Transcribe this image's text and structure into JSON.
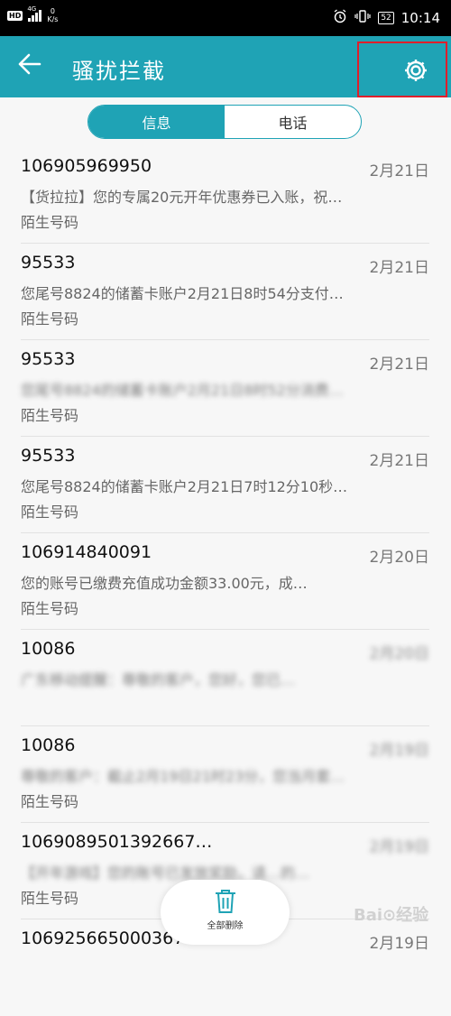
{
  "status_bar": {
    "hd": "HD",
    "signal_label": "4G",
    "speed_value": "0",
    "speed_unit": "K/s",
    "battery": "52",
    "time": "10:14"
  },
  "app_bar": {
    "title": "骚扰拦截",
    "back_icon": "arrow-left-icon",
    "settings_icon": "gear-icon",
    "highlight_color": "#e01e2b"
  },
  "tabs": [
    {
      "label": "信息",
      "active": true
    },
    {
      "label": "电话",
      "active": false
    }
  ],
  "messages": [
    {
      "sender": "106905969950",
      "date": "2月21日",
      "snippet": "【货拉拉】您的专属20元开年优惠券已入账，祝…",
      "tag": "陌生号码"
    },
    {
      "sender": "95533",
      "date": "2月21日",
      "snippet": "您尾号8824的储蓄卡账户2月21日8时54分支付…",
      "tag": "陌生号码"
    },
    {
      "sender": "95533",
      "date": "2月21日",
      "snippet": "您尾号8824的储蓄卡账户2月21日8时52分消费…",
      "tag": "陌生号码"
    },
    {
      "sender": "95533",
      "date": "2月21日",
      "snippet": "您尾号8824的储蓄卡账户2月21日7时12分10秒…",
      "tag": "陌生号码"
    },
    {
      "sender": "106914840091",
      "date": "2月20日",
      "snippet": "您的账号已缴费充值成功金额33.00元，成…",
      "tag": "陌生号码"
    },
    {
      "sender": "10086",
      "date": "2月20日",
      "snippet": "广东移动提醒：尊敬的客户，您好，您已…",
      "tag": ""
    },
    {
      "sender": "10086",
      "date": "2月19日",
      "snippet": "尊敬的客户：截止2月19日21时23分，您当月套…",
      "tag": "陌生号码"
    },
    {
      "sender": "1069089501392667…",
      "date": "2月19日",
      "snippet": "【开年游戏】您的账号已发放奖励，请…的…",
      "tag": "陌生号码"
    },
    {
      "sender": "106925665000367…",
      "date": "2月19日",
      "snippet": "",
      "tag": ""
    }
  ],
  "fab": {
    "label": "全部删除",
    "icon": "trash-icon",
    "color": "#1fa3b5"
  },
  "watermark": "Bai⊙经验",
  "colors": {
    "accent": "#1fa3b5",
    "status_bar": "#000000"
  }
}
